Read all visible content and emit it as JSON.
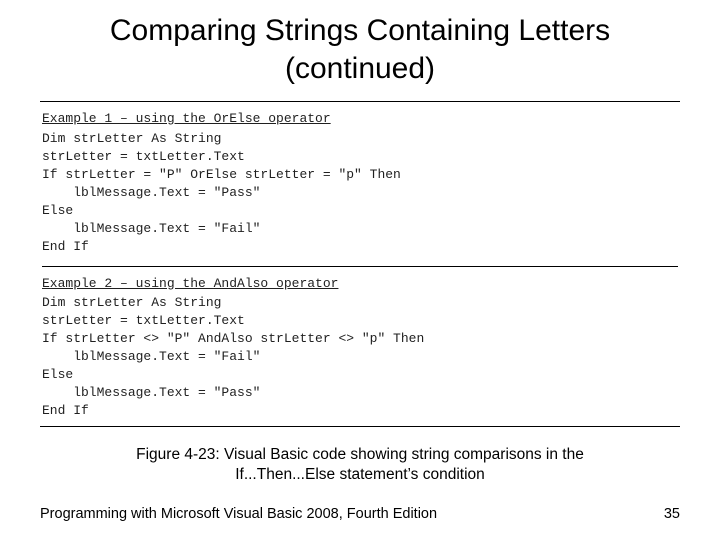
{
  "title_line1": "Comparing Strings Containing Letters",
  "title_line2": "(continued)",
  "example1": {
    "label": "Example 1 – using the OrElse operator",
    "lines": [
      "Dim strLetter As String",
      "strLetter = txtLetter.Text",
      "If strLetter = \"P\" OrElse strLetter = \"p\" Then",
      "    lblMessage.Text = \"Pass\"",
      "Else",
      "    lblMessage.Text = \"Fail\"",
      "End If"
    ]
  },
  "example2": {
    "label": "Example 2 – using the AndAlso operator",
    "lines": [
      "Dim strLetter As String",
      "strLetter = txtLetter.Text",
      "If strLetter <> \"P\" AndAlso strLetter <> \"p\" Then",
      "    lblMessage.Text = \"Fail\"",
      "Else",
      "    lblMessage.Text = \"Pass\"",
      "End If"
    ]
  },
  "caption_line1": "Figure 4-23: Visual Basic code showing string comparisons  in the",
  "caption_line2": "If...Then...Else statement’s condition",
  "footer_left": "Programming with Microsoft Visual Basic 2008, Fourth Edition",
  "footer_right": "35"
}
